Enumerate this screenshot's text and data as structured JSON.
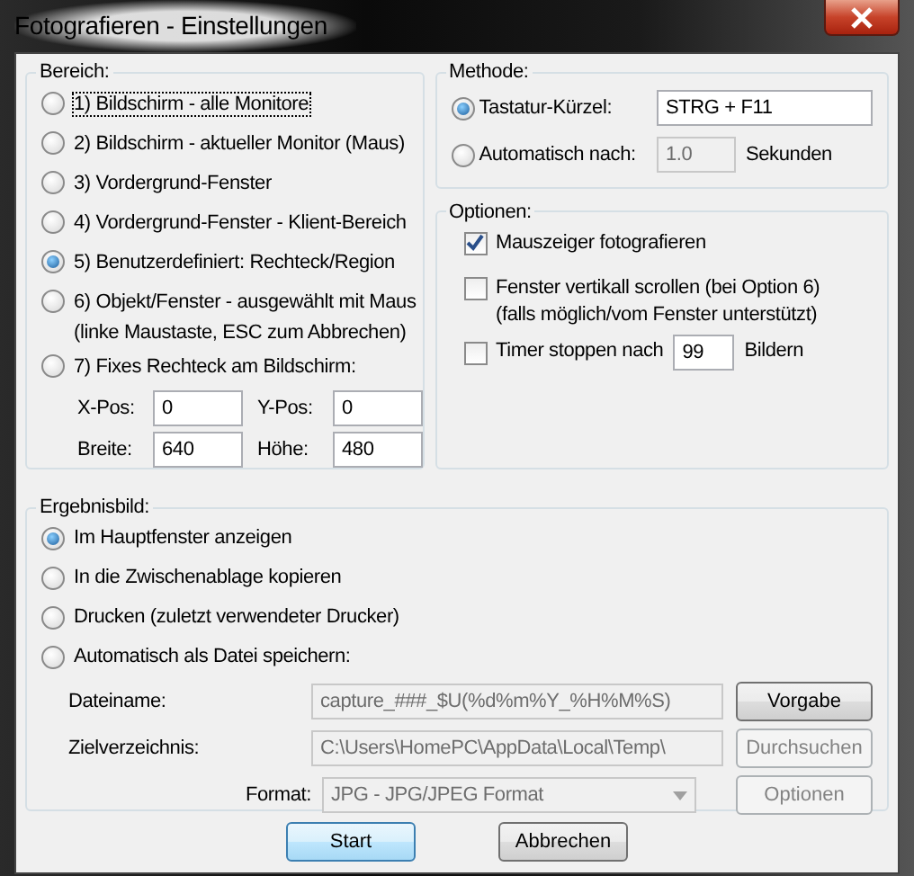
{
  "window": {
    "title": "Fotografieren - Einstellungen"
  },
  "bereich": {
    "title": "Bereich:",
    "options": [
      {
        "label": "1) Bildschirm - alle Monitore",
        "selected": false,
        "focused": true
      },
      {
        "label": "2) Bildschirm - aktueller Monitor (Maus)",
        "selected": false,
        "focused": false
      },
      {
        "label": "3) Vordergrund-Fenster",
        "selected": false,
        "focused": false
      },
      {
        "label": "4) Vordergrund-Fenster - Klient-Bereich",
        "selected": false,
        "focused": false
      },
      {
        "label": "5) Benutzerdefiniert: Rechteck/Region",
        "selected": true,
        "focused": false
      },
      {
        "label": "6) Objekt/Fenster - ausgewählt mit Maus",
        "note": "(linke Maustaste, ESC zum Abbrechen)",
        "selected": false,
        "focused": false
      },
      {
        "label": "7) Fixes Rechteck am Bildschirm:",
        "selected": false,
        "focused": false
      }
    ],
    "fields": [
      {
        "label": "X-Pos:",
        "value": "0"
      },
      {
        "label": "Y-Pos:",
        "value": "0"
      },
      {
        "label": "Breite:",
        "value": "640"
      },
      {
        "label": "Höhe:",
        "value": "480"
      }
    ]
  },
  "methode": {
    "title": "Methode:",
    "options": [
      {
        "label": "Tastatur-Kürzel:",
        "selected": true,
        "value": "STRG + F11",
        "disabled": false
      },
      {
        "label": "Automatisch nach:",
        "selected": false,
        "value": "1.0",
        "disabled": true,
        "unit": "Sekunden"
      }
    ]
  },
  "optionen": {
    "title": "Optionen:",
    "checks": [
      {
        "label": "Mauszeiger fotografieren",
        "checked": true
      },
      {
        "label": "Fenster vertikall scrollen (bei Option 6)",
        "note": "(falls möglich/vom Fenster unterstützt)",
        "checked": false
      },
      {
        "label": "Timer stoppen nach",
        "value": "99",
        "unit": "Bildern",
        "checked": false
      }
    ]
  },
  "ergebnisbild": {
    "title": "Ergebnisbild:",
    "options": [
      {
        "label": "Im Hauptfenster anzeigen",
        "selected": true
      },
      {
        "label": "In die Zwischenablage kopieren",
        "selected": false
      },
      {
        "label": "Drucken (zuletzt verwendeter Drucker)",
        "selected": false
      },
      {
        "label": "Automatisch als Datei speichern:",
        "selected": false
      }
    ],
    "rows": [
      {
        "kind": "text",
        "label": "Dateiname:",
        "value": "capture_###_$U(%d%m%Y_%H%M%S)",
        "disabled": true,
        "button": "Vorgabe",
        "button_disabled": false
      },
      {
        "kind": "text",
        "label": "Zielverzeichnis:",
        "value": "C:\\Users\\HomePC\\AppData\\Local\\Temp\\",
        "disabled": true,
        "button": "Durchsuchen",
        "button_disabled": true
      },
      {
        "kind": "select",
        "label": "Format:",
        "value": "JPG - JPG/JPEG Format",
        "disabled": true,
        "button": "Optionen",
        "button_disabled": true
      }
    ]
  },
  "buttons": [
    {
      "label": "Start",
      "default": true
    },
    {
      "label": "Abbrechen",
      "default": false
    }
  ]
}
